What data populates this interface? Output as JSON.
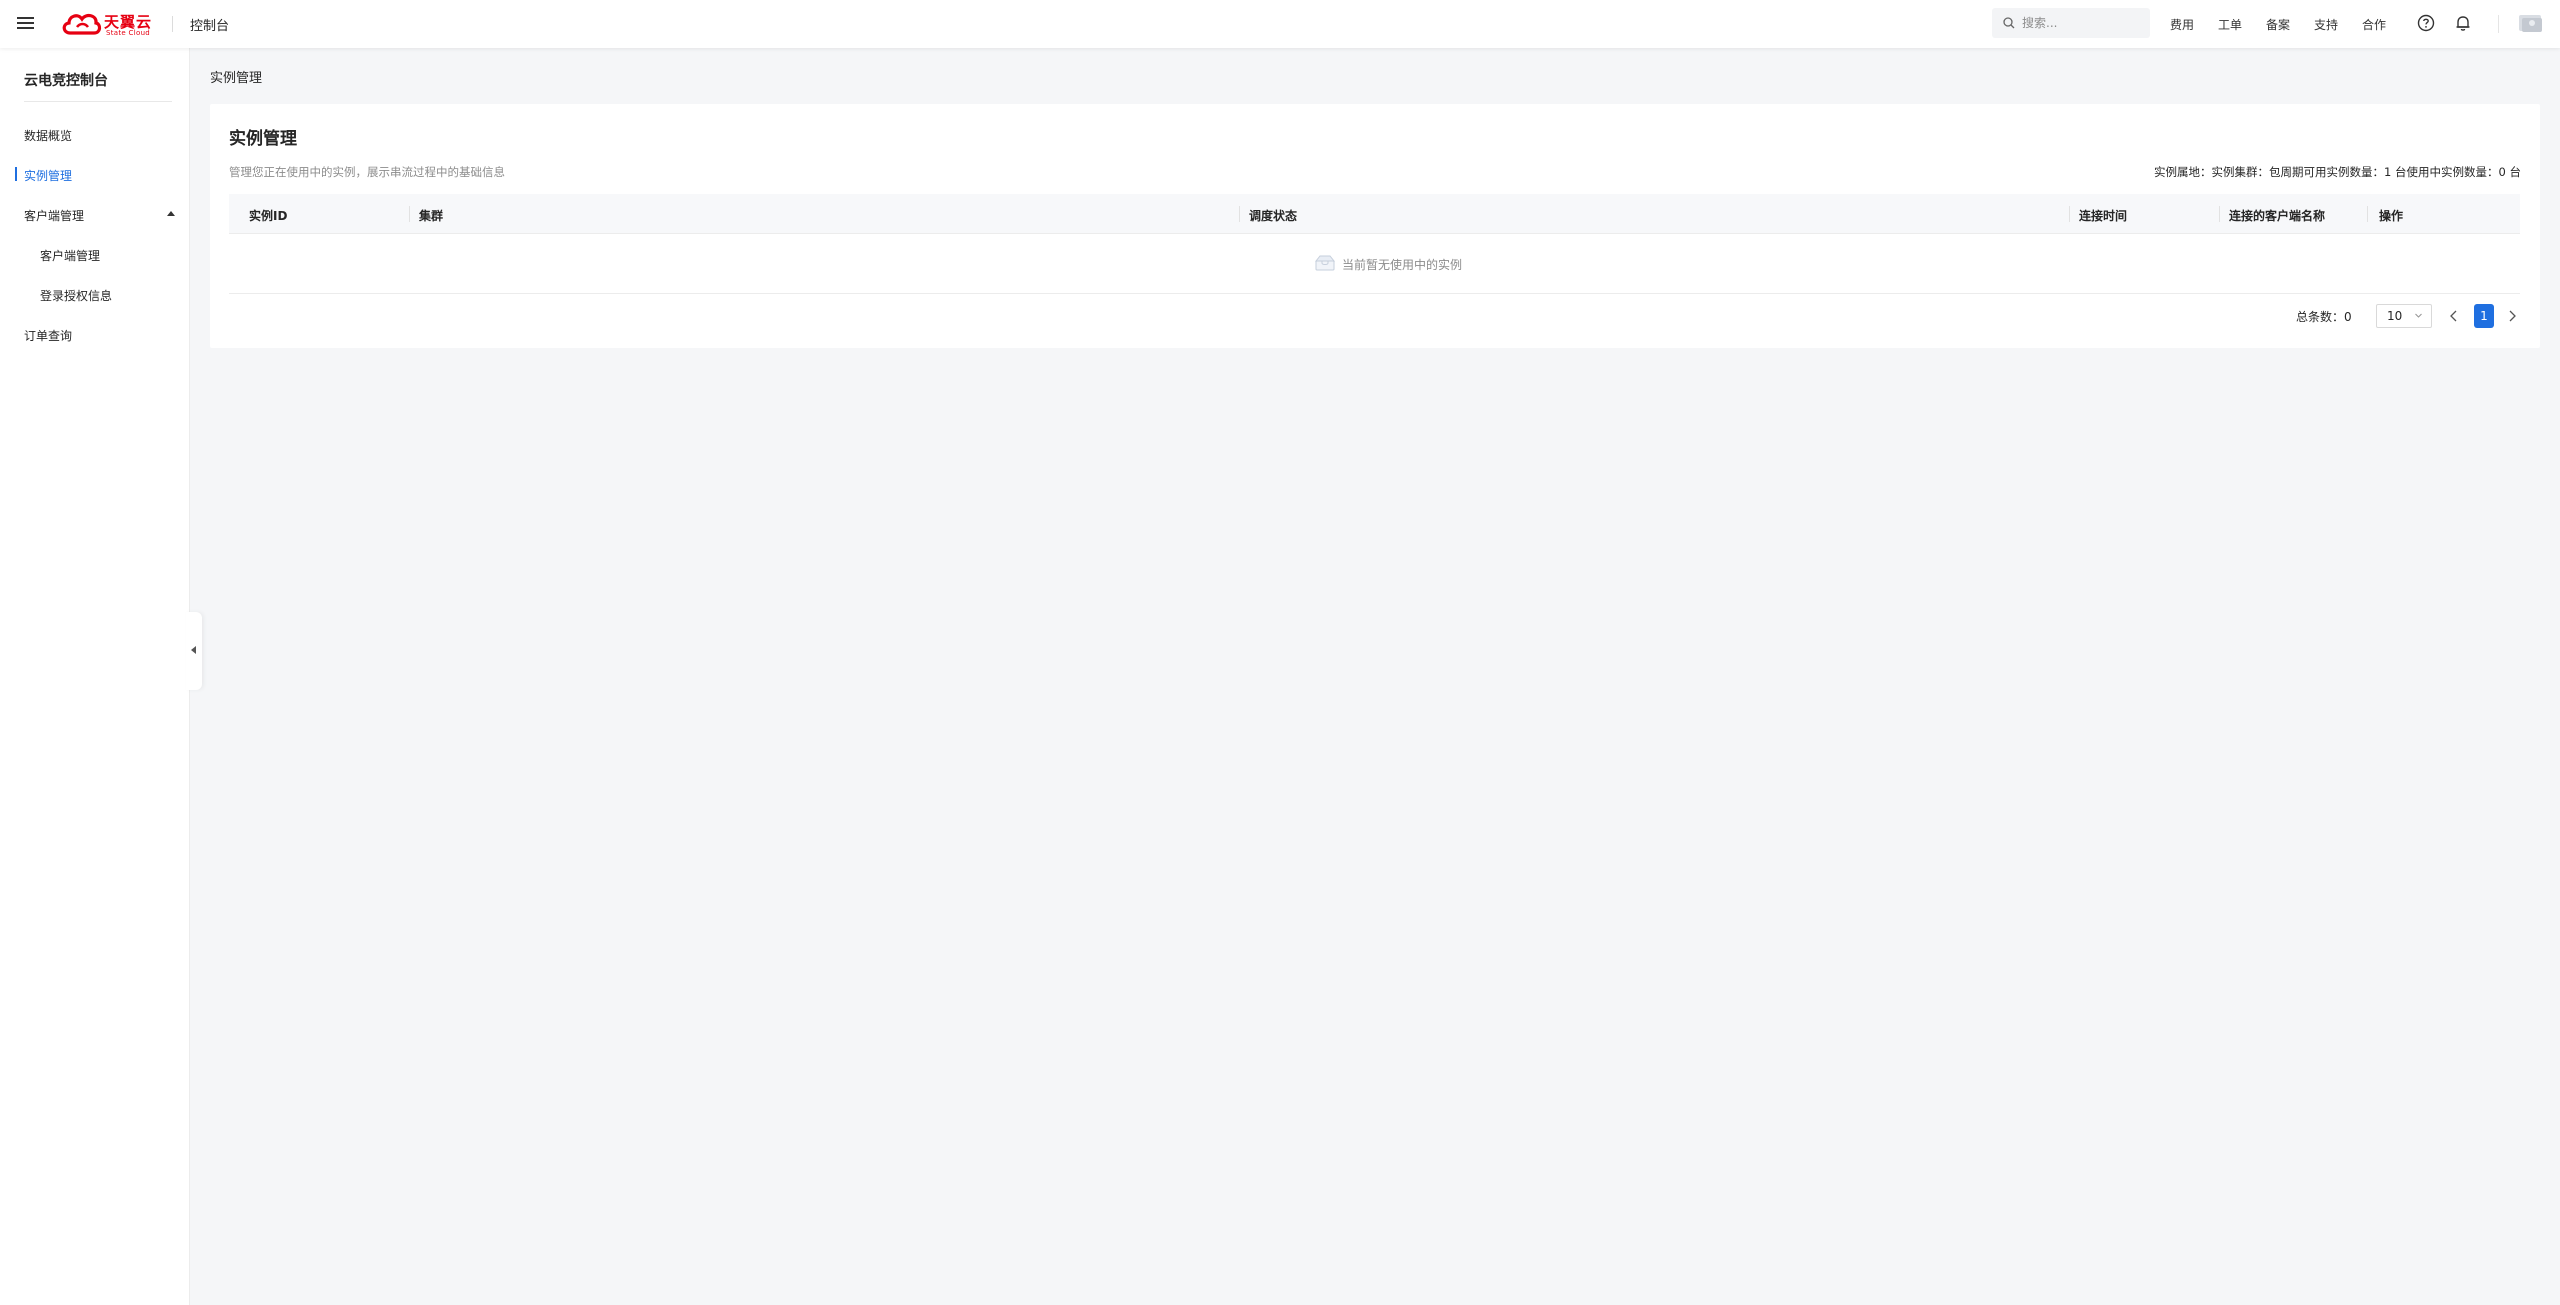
{
  "header": {
    "logo_cn": "天翼云",
    "logo_en": "State Cloud",
    "console_label": "控制台",
    "search_placeholder": "搜索...",
    "nav": [
      "费用",
      "工单",
      "备案",
      "支持",
      "合作"
    ]
  },
  "sidebar": {
    "title": "云电竞控制台",
    "items": [
      {
        "label": "数据概览"
      },
      {
        "label": "实例管理",
        "active": true
      },
      {
        "label": "客户端管理",
        "expanded": true
      },
      {
        "label": "客户端管理"
      },
      {
        "label": "登录授权信息"
      },
      {
        "label": "订单查询"
      }
    ]
  },
  "breadcrumb": "实例管理",
  "card": {
    "title": "实例管理",
    "description": "管理您正在使用中的实例，展示串流过程中的基础信息",
    "stats": "实例属地：实例集群：包周期可用实例数量：1 台使用中实例数量：0 台",
    "columns": [
      "实例ID",
      "集群",
      "调度状态",
      "连接时间",
      "连接的客户端名称",
      "操作"
    ],
    "empty_text": "当前暂无使用中的实例",
    "total_label": "总条数：0",
    "page_size": "10",
    "current_page": "1"
  },
  "colors": {
    "accent": "#1f6fe0",
    "brand_red": "#e60012"
  }
}
